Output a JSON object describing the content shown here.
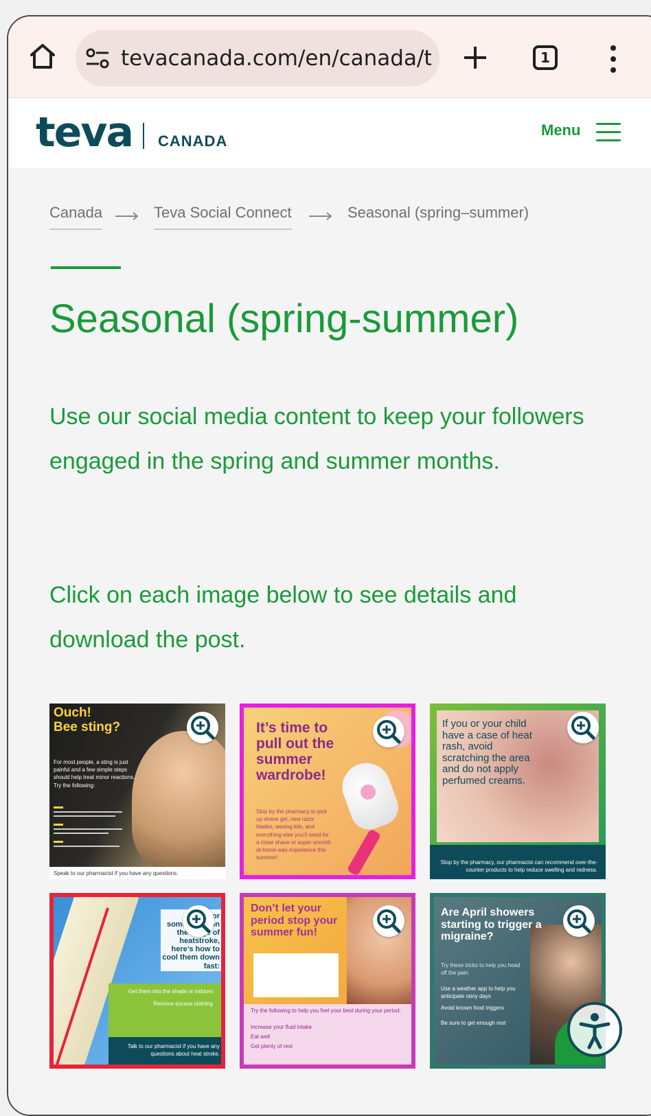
{
  "browser": {
    "url": "tevacanada.com/en/canada/te",
    "tab_count": "1"
  },
  "site": {
    "logo": "teva",
    "country": "CANADA",
    "menu_label": "Menu"
  },
  "breadcrumb": [
    {
      "label": "Canada"
    },
    {
      "label": "Teva Social Connect"
    },
    {
      "label": "Seasonal (spring–summer)"
    }
  ],
  "page": {
    "title": "Seasonal (spring-summer)",
    "intro": "Use our social media content to keep your followers engaged in the spring and summer months.",
    "instruction": "Click on each image below to see details and download the post."
  },
  "tiles": [
    {
      "heading": "Ouch!\nBee sting?",
      "body": "For most people, a sting is just painful and a few simple steps should help treat minor reactions. Try the following:",
      "footer": "Speak to our pharmacist if you have any questions."
    },
    {
      "heading": "It’s time to pull out the summer wardrobe!",
      "body": "Stop by the pharmacy to pick up shave gel, new razor blades, waxing kits, and everything else you’ll need for a close shave or super smooth at-home wax experience this summer!"
    },
    {
      "heading": "If you or your child have a case of heat rash, avoid scratching the area and do not apply perfumed creams.",
      "footer": "Stop by the pharmacy, our pharmacist can recommend over-the-counter products to help reduce swelling and redness."
    },
    {
      "heading": "If you or someone is on the verge of heatstroke, here’s how to cool them down fast:",
      "items": [
        "Get them into the shade or indoors",
        "Remove excess clothing"
      ],
      "footer": "Talk to our pharmacist if you have any questions about heat stroke."
    },
    {
      "heading": "Don’t let your period stop your summer fun!",
      "body": "Try the following to help you feel your best during your period:",
      "items": [
        "Increase your fluid intake",
        "Eat well",
        "Get plenty of rest"
      ]
    },
    {
      "heading": "Are April showers starting to trigger a migraine?",
      "body": "Try these tricks to help you head off the pain.",
      "items": [
        "Use a weather app to help you anticipate rainy days",
        "Avoid known food triggers",
        "Be sure to get enough rest"
      ]
    }
  ],
  "colors": {
    "brand_green": "#1a9a3a",
    "brand_teal": "#0e4b5a",
    "tile2_border": "#e81fe0",
    "tile4_border": "#e8223a"
  },
  "icons": [
    "home-icon",
    "site-settings-icon",
    "plus-icon",
    "tab-count-icon",
    "more-vert-icon",
    "hamburger-icon",
    "zoom-in-icon",
    "accessibility-icon"
  ]
}
